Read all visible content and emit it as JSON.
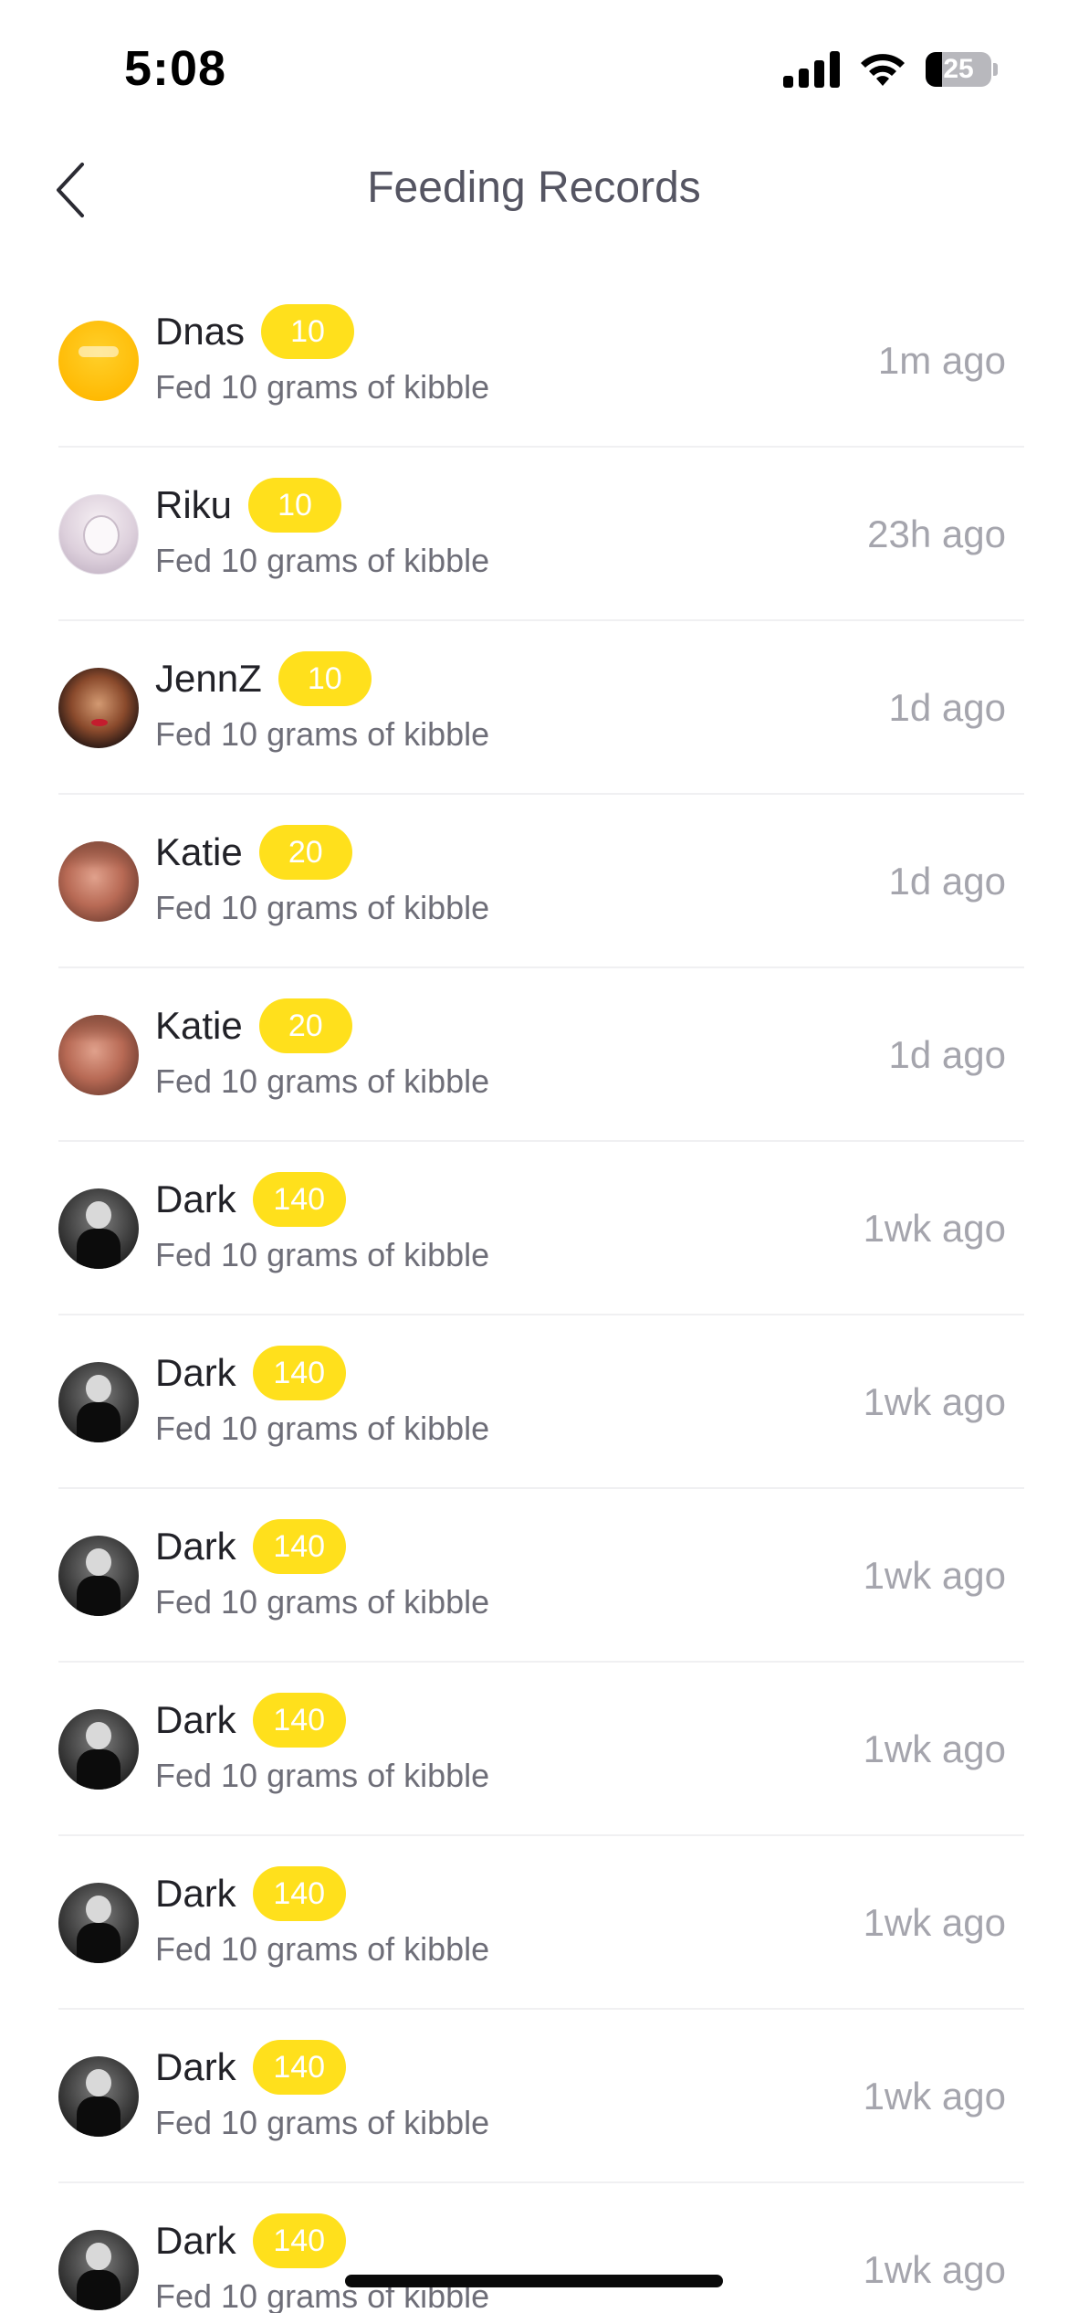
{
  "status_bar": {
    "time": "5:08",
    "battery_level": "25",
    "battery_fraction": 0.25,
    "icons": [
      "cellular-signal-icon",
      "wifi-icon",
      "battery-icon"
    ]
  },
  "nav": {
    "title": "Feeding Records",
    "back_icon": "chevron-left-icon"
  },
  "colors": {
    "badge": "#ffe01c",
    "title": "#555562",
    "name": "#222228",
    "description": "#6e6e78",
    "time": "#a5a5ad",
    "divider": "#f0f0f2"
  },
  "records": [
    {
      "name": "Dnas",
      "level": "10",
      "description": "Fed 10 grams of kibble",
      "time": "1m ago"
    },
    {
      "name": "Riku",
      "level": "10",
      "description": "Fed 10 grams of kibble",
      "time": "23h ago"
    },
    {
      "name": "JennZ",
      "level": "10",
      "description": "Fed 10 grams of kibble",
      "time": "1d ago"
    },
    {
      "name": "Katie",
      "level": "20",
      "description": "Fed 10 grams of kibble",
      "time": "1d ago"
    },
    {
      "name": "Katie",
      "level": "20",
      "description": "Fed 10 grams of kibble",
      "time": "1d ago"
    },
    {
      "name": "Dark",
      "level": "140",
      "description": "Fed 10 grams of kibble",
      "time": "1wk ago"
    },
    {
      "name": "Dark",
      "level": "140",
      "description": "Fed 10 grams of kibble",
      "time": "1wk ago"
    },
    {
      "name": "Dark",
      "level": "140",
      "description": "Fed 10 grams of kibble",
      "time": "1wk ago"
    },
    {
      "name": "Dark",
      "level": "140",
      "description": "Fed 10 grams of kibble",
      "time": "1wk ago"
    },
    {
      "name": "Dark",
      "level": "140",
      "description": "Fed 10 grams of kibble",
      "time": "1wk ago"
    },
    {
      "name": "Dark",
      "level": "140",
      "description": "Fed 10 grams of kibble",
      "time": "1wk ago"
    },
    {
      "name": "Dark",
      "level": "140",
      "description": "Fed 10 grams of kibble",
      "time": "1wk ago"
    }
  ]
}
